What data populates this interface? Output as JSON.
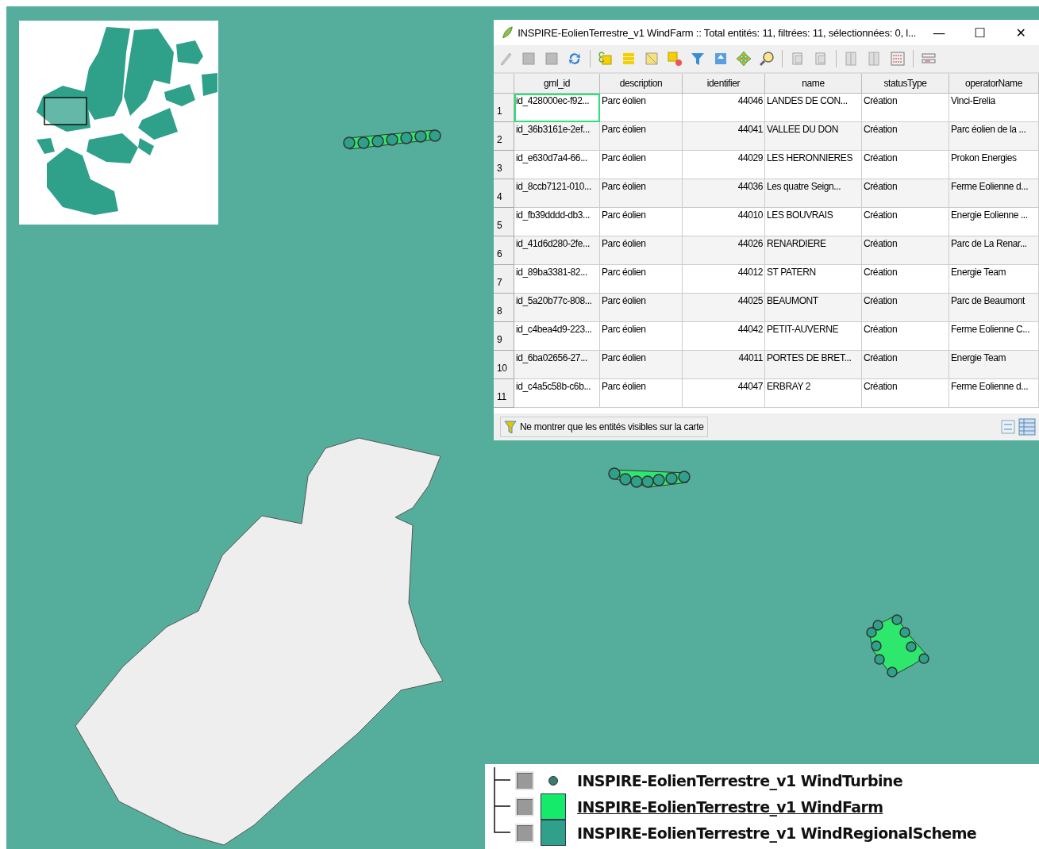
{
  "attribute_window": {
    "title": "INSPIRE-EolienTerrestre_v1 WindFarm :: Total entités: 11, filtrées: 11, sélectionnées: 0, l...",
    "minimize": "—",
    "maximize": "☐",
    "close": "✕"
  },
  "table": {
    "columns": [
      "gml_id",
      "description",
      "identifier",
      "name",
      "statusType",
      "operatorName"
    ],
    "rows": [
      {
        "number": "1",
        "focused": true,
        "cells": [
          "id_428000ec-f92...",
          "Parc éolien",
          "44046",
          "LANDES DE CON...",
          "Création",
          "Vinci-Erelia"
        ]
      },
      {
        "number": "2",
        "focused": false,
        "cells": [
          "id_36b3161e-2ef...",
          "Parc éolien",
          "44041",
          "VALLEE DU DON",
          "Création",
          "Parc éolien de la ..."
        ]
      },
      {
        "number": "3",
        "focused": false,
        "cells": [
          "id_e630d7a4-66...",
          "Parc éolien",
          "44029",
          "LES HERONNIERES",
          "Création",
          "Prokon Energies"
        ]
      },
      {
        "number": "4",
        "focused": false,
        "cells": [
          "id_8ccb7121-010...",
          "Parc éolien",
          "44036",
          "Les quatre Seign...",
          "Création",
          "Ferme Eolienne d..."
        ]
      },
      {
        "number": "5",
        "focused": false,
        "cells": [
          "id_fb39dddd-db3...",
          "Parc éolien",
          "44010",
          "LES BOUVRAIS",
          "Création",
          "Energie Eolienne ..."
        ]
      },
      {
        "number": "6",
        "focused": false,
        "cells": [
          "id_41d6d280-2fe...",
          "Parc éolien",
          "44026",
          "RENARDIERE",
          "Création",
          "Parc de La Renar..."
        ]
      },
      {
        "number": "7",
        "focused": false,
        "cells": [
          "id_89ba3381-82...",
          "Parc éolien",
          "44012",
          "ST PATERN",
          "Création",
          "Energie Team"
        ]
      },
      {
        "number": "8",
        "focused": false,
        "cells": [
          "id_5a20b77c-808...",
          "Parc éolien",
          "44025",
          "BEAUMONT",
          "Création",
          "Parc de Beaumont"
        ]
      },
      {
        "number": "9",
        "focused": false,
        "cells": [
          "id_c4bea4d9-223...",
          "Parc éolien",
          "44042",
          "PETIT-AUVERNE",
          "Création",
          "Ferme Eolienne C..."
        ]
      },
      {
        "number": "10",
        "focused": false,
        "cells": [
          "id_6ba02656-27...",
          "Parc éolien",
          "44011",
          "PORTES DE BRET...",
          "Création",
          "Energie Team"
        ]
      },
      {
        "number": "11",
        "focused": false,
        "cells": [
          "id_c4a5c58b-c6b...",
          "Parc éolien",
          "44047",
          "ERBRAY 2",
          "Création",
          "Ferme Eolienne d..."
        ]
      }
    ]
  },
  "filter_button": {
    "label": "Ne montrer que les entités visibles sur la carte"
  },
  "legend": [
    {
      "kind": "point",
      "label": "INSPIRE-EolienTerrestre_v1 WindTurbine",
      "color": "#3d7a6c",
      "selected": false,
      "checked": true
    },
    {
      "kind": "fill",
      "label": "INSPIRE-EolienTerrestre_v1 WindFarm",
      "color": "#16ea6a",
      "selected": true,
      "checked": true
    },
    {
      "kind": "fill",
      "label": "INSPIRE-EolienTerrestre_v1 WindRegionalScheme",
      "color": "#2fa08a",
      "selected": false,
      "checked": true
    }
  ]
}
